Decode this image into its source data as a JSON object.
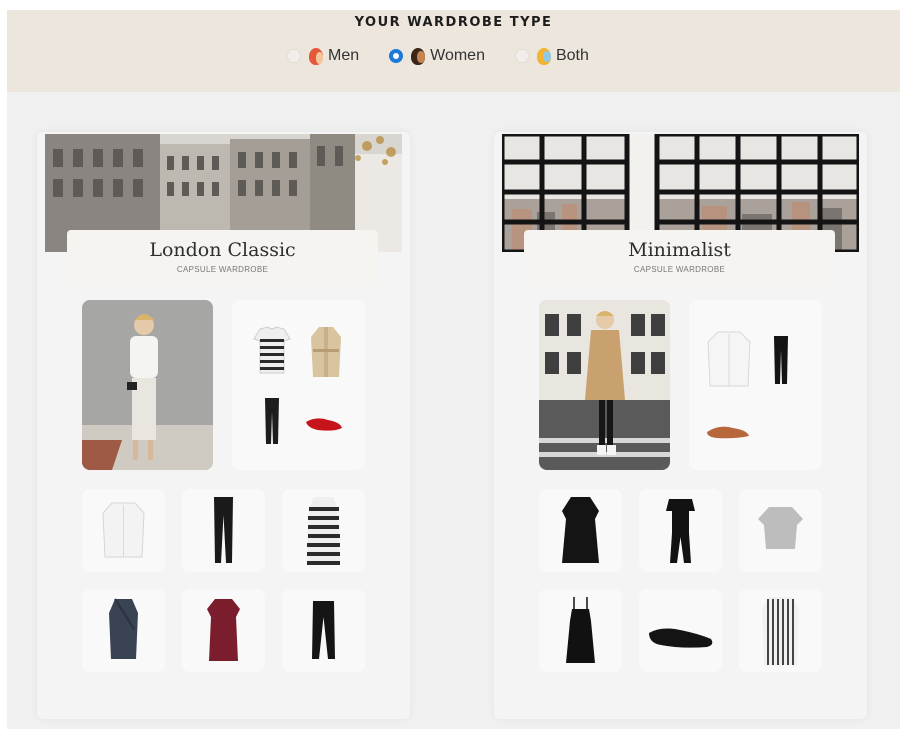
{
  "header": {
    "title": "YOUR WARDROBE TYPE",
    "options": [
      {
        "label": "Men",
        "checked": false,
        "icon": "man-face-icon"
      },
      {
        "label": "Women",
        "checked": true,
        "icon": "woman-face-icon"
      },
      {
        "label": "Both",
        "checked": false,
        "icon": "person-face-icon"
      }
    ]
  },
  "cards": [
    {
      "title": "London Classic",
      "subtitle": "CAPSULE WARDROBE",
      "banner": "london-buildings-banner",
      "outfit_items": [
        "striped-tshirt-icon",
        "trench-coat-icon",
        "black-trousers-icon",
        "red-flat-shoe-icon"
      ],
      "grid_items": [
        "white-shirt-icon",
        "black-trousers-icon",
        "striped-dress-icon",
        "navy-wrap-dress-icon",
        "burgundy-dress-icon",
        "black-pants-icon"
      ]
    },
    {
      "title": "Minimalist",
      "subtitle": "CAPSULE WARDROBE",
      "banner": "city-window-banner",
      "outfit_items": [
        "white-shirt-icon",
        "black-jeans-icon",
        "brown-mule-icon"
      ],
      "grid_items": [
        "black-dress-icon",
        "black-jumpsuit-icon",
        "grey-top-icon",
        "black-slip-dress-icon",
        "black-loafer-icon",
        "striped-shirt-dress-icon"
      ]
    }
  ],
  "colors": {
    "accent": "#1e7ad8",
    "header_bg": "#ede6dc",
    "page_bg": "#f0f0f0"
  }
}
